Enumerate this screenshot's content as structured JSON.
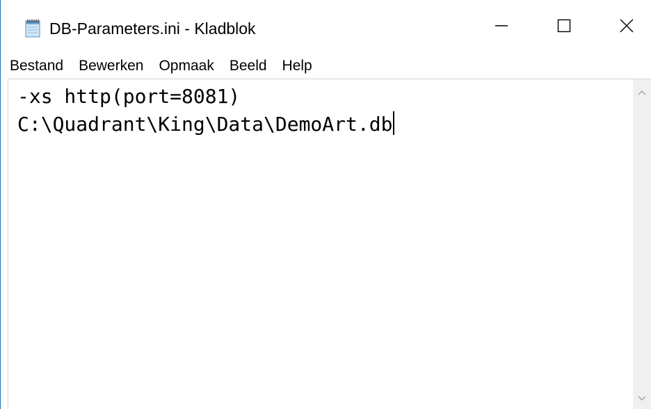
{
  "window": {
    "title": "DB-Parameters.ini - Kladblok",
    "icon": "notepad-icon",
    "controls": {
      "minimize": "minimize-icon",
      "maximize": "maximize-icon",
      "close": "close-icon"
    }
  },
  "menu": {
    "items": [
      {
        "label": "Bestand"
      },
      {
        "label": "Bewerken"
      },
      {
        "label": "Opmaak"
      },
      {
        "label": "Beeld"
      },
      {
        "label": "Help"
      }
    ]
  },
  "editor": {
    "lines": [
      "-xs http(port=8081)",
      "C:\\Quadrant\\King\\Data\\DemoArt.db"
    ]
  },
  "colors": {
    "window_border": "#1a6fc4",
    "scrollbar_track": "#f0f0f0",
    "scroll_arrow": "#a0a0a0"
  }
}
